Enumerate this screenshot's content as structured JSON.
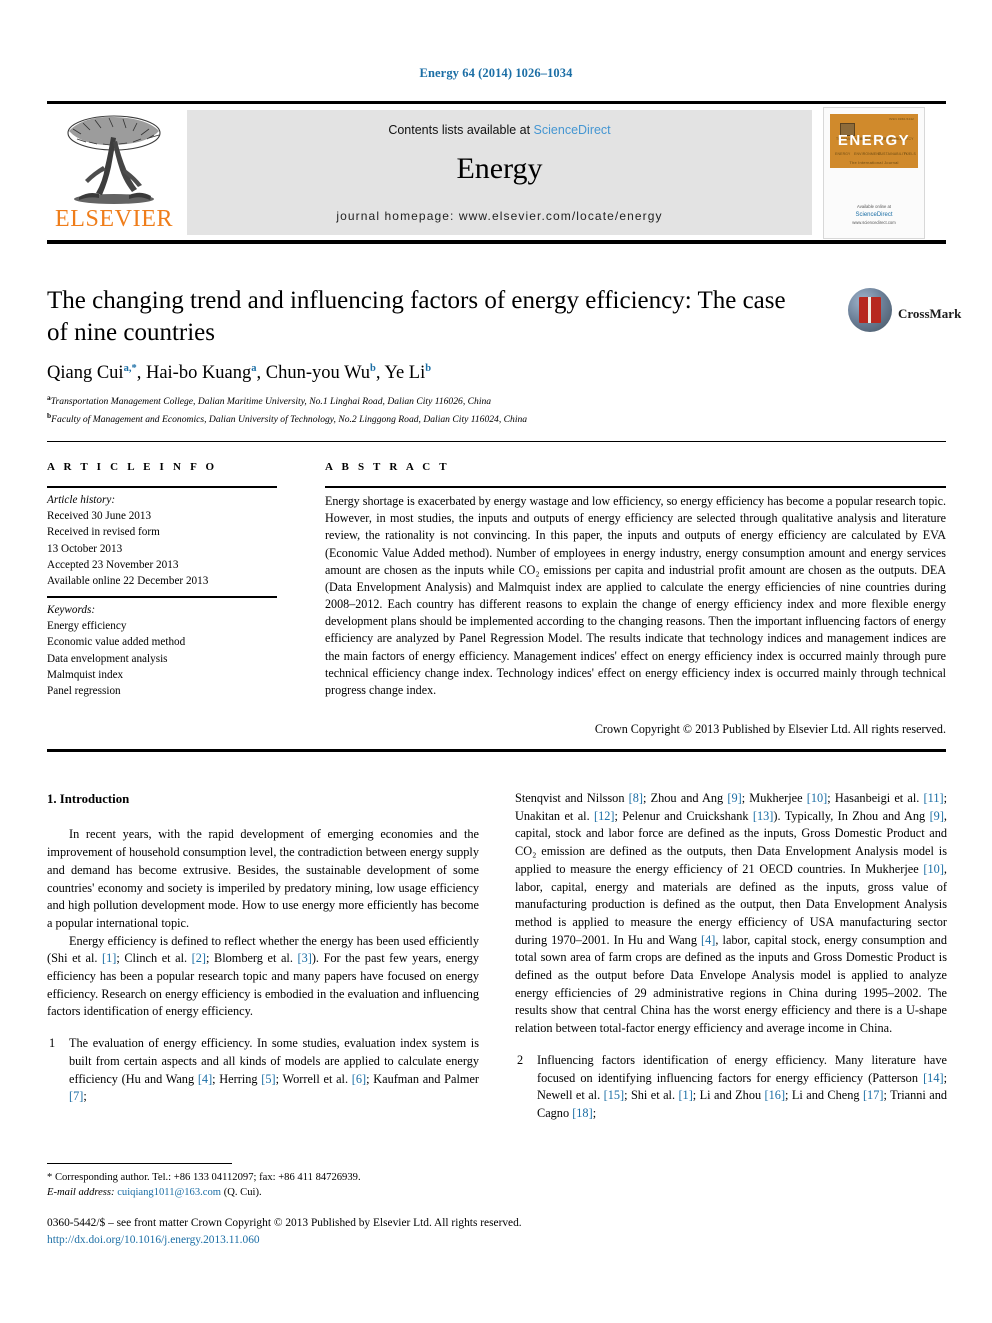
{
  "running_head": "Energy 64 (2014) 1026–1034",
  "masthead": {
    "publisher_name": "ELSEVIER",
    "contents_prefix": "Contents lists available at ",
    "contents_link": "ScienceDirect",
    "journal_name": "Energy",
    "homepage": "journal homepage: www.elsevier.com/locate/energy",
    "cover": {
      "band_title": "ENERGY",
      "band_subtitle": "The International Journal",
      "top_right_note": "ISSN 0360-5442",
      "header_labels": [
        "THERMAL SCIENCE",
        "ENERGY SYSTEMS",
        "RENEWABLE",
        "POLICY"
      ],
      "footer_labels": [
        "ENERGY",
        "ENVIRONMENT",
        "SUSTAINABILITY",
        "FUELS"
      ],
      "footer_note": "Available online at",
      "footer_logo": "ScienceDirect",
      "footer_url": "www.sciencedirect.com"
    }
  },
  "article": {
    "title": "The changing trend and influencing factors of energy efficiency: The case of nine countries",
    "crossmark_label": "CrossMark",
    "authors_html": "Qiang Cui<sup>a,*</sup>, Hai-bo Kuang<sup>a</sup>, Chun-you Wu<sup>b</sup>, Ye Li<sup>b</sup>",
    "affiliations": [
      "Transportation Management College, Dalian Maritime University, No.1 Linghai Road, Dalian City 116026, China",
      "Faculty of Management and Economics, Dalian University of Technology, No.2 Linggong Road, Dalian City 116024, China"
    ]
  },
  "article_info": {
    "heading": "A R T I C L E   I N F O",
    "history_label": "Article history:",
    "history": [
      "Received 30 June 2013",
      "Received in revised form",
      "13 October 2013",
      "Accepted 23 November 2013",
      "Available online 22 December 2013"
    ],
    "keywords_label": "Keywords:",
    "keywords": [
      "Energy efficiency",
      "Economic value added method",
      "Data envelopment analysis",
      "Malmquist index",
      "Panel regression"
    ]
  },
  "abstract": {
    "heading": "A B S T R A C T",
    "text": "Energy shortage is exacerbated by energy wastage and low efficiency, so energy efficiency has become a popular research topic. However, in most studies, the inputs and outputs of energy efficiency are selected through qualitative analysis and literature review, the rationality is not convincing. In this paper, the inputs and outputs of energy efficiency are calculated by EVA (Economic Value Added method). Number of employees in energy industry, energy consumption amount and energy services amount are chosen as the inputs while CO₂ emissions per capita and industrial profit amount are chosen as the outputs. DEA (Data Envelopment Analysis) and Malmquist index are applied to calculate the energy efficiencies of nine countries during 2008–2012. Each country has different reasons to explain the change of energy efficiency index and more flexible energy development plans should be implemented according to the changing reasons. Then the important influencing factors of energy efficiency are analyzed by Panel Regression Model. The results indicate that technology indices and management indices are the main factors of energy efficiency. Management indices' effect on energy efficiency index is occurred mainly through pure technical efficiency change index. Technology indices' effect on energy efficiency index is occurred mainly through technical progress change index.",
    "copyright": "Crown Copyright © 2013 Published by Elsevier Ltd. All rights reserved."
  },
  "body": {
    "section_heading": "1. Introduction",
    "left_paragraph_1": "In recent years, with the rapid development of emerging economies and the improvement of household consumption level, the contradiction between energy supply and demand has become extrusive. Besides, the sustainable development of some countries' economy and society is imperiled by predatory mining, low usage efficiency and high pollution development mode. How to use energy more efficiently has become a popular international topic.",
    "left_paragraph_2_part1": "Energy efficiency is defined to reflect whether the energy has been used efficiently (Shi et al. ",
    "left_paragraph_2_refs": [
      "[1]",
      "[2]",
      "[3]"
    ],
    "left_paragraph_2_part2": "; Clinch et al. ",
    "left_paragraph_2_part3": "; Blomberg et al. ",
    "left_paragraph_2_part4": "). For the past few years, energy efficiency has been a popular research topic and many papers have focused on energy efficiency. Research on energy efficiency is embodied in the evaluation and influencing factors identification of energy efficiency.",
    "list_item_1_number": "1",
    "list_item_1_text_a": "The evaluation of energy efficiency. In some studies, evaluation index system is built from certain aspects and all kinds of models are applied to calculate energy efficiency (Hu and Wang ",
    "list_item_1_refs": [
      "[4]",
      "[5]",
      "[6]",
      "[7]"
    ],
    "list_item_1_text_b": "; Herring ",
    "list_item_1_text_c": "; Worrell et al. ",
    "list_item_1_text_d": "; Kaufman and Palmer ",
    "list_item_1_text_e": ";",
    "right_continuation_a": "Stenqvist and Nilsson ",
    "right_refs_1": [
      "[8]",
      "[9]",
      "[10]",
      "[11]",
      "[12]",
      "[13]"
    ],
    "right_text_b": "; Zhou and Ang ",
    "right_text_c": "; Mukherjee ",
    "right_text_d": "; Hasanbeigi et al. ",
    "right_text_e": "; Unakitan et al. ",
    "right_text_f": "; Pelenur and Cruickshank ",
    "right_text_g": "). Typically, In Zhou and Ang ",
    "right_text_h": ", capital, stock and labor force are defined as the inputs, Gross Domestic Product and CO₂ emission are defined as the outputs, then Data Envelopment Analysis model is applied to measure the energy efficiency of 21 OECD countries. In Mukherjee ",
    "right_text_i": ", labor, capital, energy and materials are defined as the inputs, gross value of manufacturing production is defined as the output, then Data Envelopment Analysis method is applied to measure the energy efficiency of USA manufacturing sector during 1970–2001. In Hu and Wang ",
    "right_text_j": ", labor, capital stock, energy consumption and total sown area of farm crops are defined as the inputs and Gross Domestic Product is defined as the output before Data Envelope Analysis model is applied to analyze energy efficiencies of 29 administrative regions in China during 1995–2002. The results show that central China has the worst energy efficiency and there is a U-shape relation between total-factor energy efficiency and average income in China.",
    "list_item_2_number": "2",
    "list_item_2_text_a": "Influencing factors identification of energy efficiency. Many literature have focused on identifying influencing factors for energy efficiency (Patterson ",
    "list_item_2_refs": [
      "[14]",
      "[15]",
      "[1]",
      "[16]",
      "[17]",
      "[18]"
    ],
    "list_item_2_text_b": "; Newell et al. ",
    "list_item_2_text_c": "; Shi et al. ",
    "list_item_2_text_d": "; Li and Zhou ",
    "list_item_2_text_e": "; Li and Cheng ",
    "list_item_2_text_f": "; Trianni and Cagno ",
    "list_item_2_text_g": ";"
  },
  "footnotes": {
    "corresponding": "* Corresponding author. Tel.: +86 133 04112097; fax: +86 411 84726939.",
    "email_label": "E-mail address:",
    "email": "cuiqiang1011@163.com",
    "email_suffix": "(Q. Cui)."
  },
  "footer": {
    "copyright_line": "0360-5442/$ – see front matter Crown Copyright © 2013 Published by Elsevier Ltd. All rights reserved.",
    "doi": "http://dx.doi.org/10.1016/j.energy.2013.11.060"
  },
  "colors": {
    "link_blue": "#1b6ea5",
    "elsevier_orange": "#ef7d1a",
    "banner_gray": "#e3e3e3",
    "sciencedirect_blue": "#4596d2"
  }
}
